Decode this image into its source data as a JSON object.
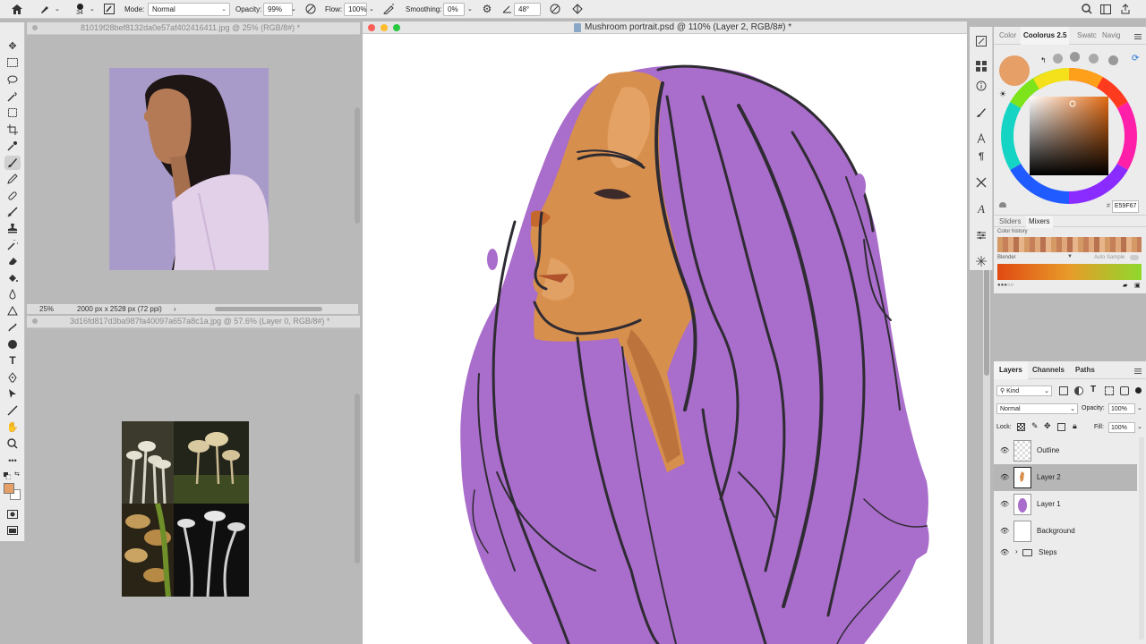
{
  "options_bar": {
    "brush_size": "34",
    "mode_label": "Mode:",
    "mode_value": "Normal",
    "opacity_label": "Opacity:",
    "opacity_value": "99%",
    "flow_label": "Flow:",
    "flow_value": "100%",
    "smoothing_label": "Smoothing:",
    "smoothing_value": "0%",
    "angle_value": "48°"
  },
  "doc1": {
    "tab_title": "81019f28bef8132da0e57af402416411.jpg @ 25% (RGB/8#) *",
    "zoom": "25%",
    "dimensions": "2000 px x 2528 px (72 ppi)"
  },
  "doc2": {
    "tab_title": "3d16fd817d3ba987fa40097a657a8c1a.jpg @ 57.6% (Layer 0, RGB/8#) *"
  },
  "main_doc": {
    "title": "Mushroom portrait.psd @ 110% (Layer 2, RGB/8#) *"
  },
  "color_panel": {
    "tabs": [
      "Color",
      "Coolorus 2.5",
      "Swatc",
      "Navig"
    ],
    "active_tab": "Coolorus 2.5",
    "hex_prefix": "#",
    "hex": "E59F67",
    "swatch_color": "#E59F67",
    "subtabs": [
      "Sliders",
      "Mixers"
    ],
    "color_history_label": "Color history",
    "blender_label": "Blender",
    "auto_sample_label": "Auto Sample"
  },
  "layers_panel": {
    "tabs": [
      "Layers",
      "Channels",
      "Paths"
    ],
    "filter_label": "Kind",
    "blend_mode": "Normal",
    "opacity_label": "Opacity:",
    "opacity_value": "100%",
    "lock_label": "Lock:",
    "fill_label": "Fill:",
    "fill_value": "100%",
    "layers": [
      {
        "name": "Outline",
        "selected": false
      },
      {
        "name": "Layer 2",
        "selected": true
      },
      {
        "name": "Layer 1",
        "selected": false
      },
      {
        "name": "Background",
        "selected": false
      }
    ],
    "group_name": "Steps"
  },
  "colors": {
    "foreground": "#E59F67",
    "background": "#FFFFFF",
    "hair_purple": "#A66BC9",
    "skin": "#D9924E"
  }
}
